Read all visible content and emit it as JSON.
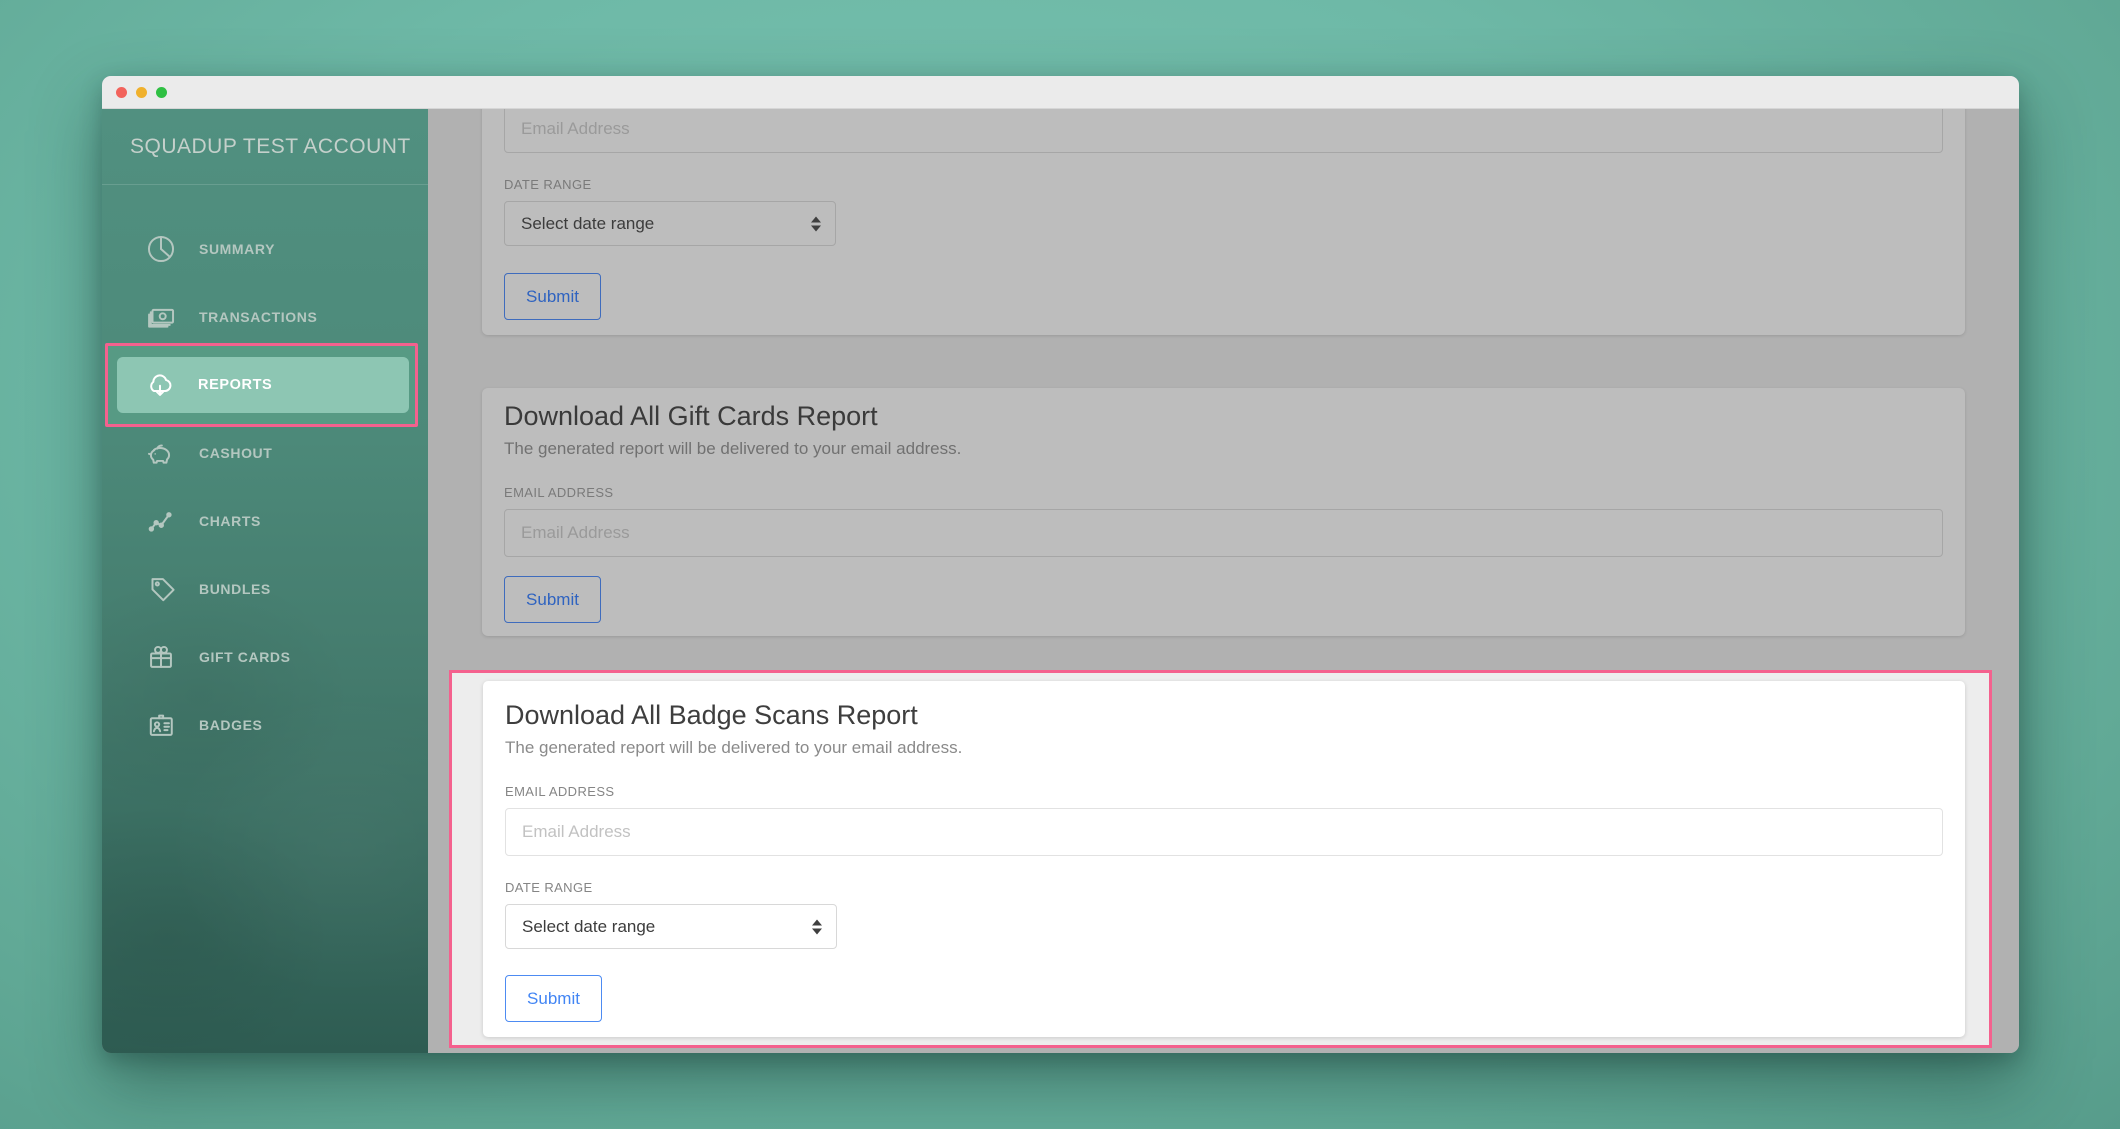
{
  "window": {
    "traffic_lights": [
      "#f2635c",
      "#f0b12d",
      "#2fc043"
    ]
  },
  "sidebar": {
    "account_name": "SQUADUP TEST ACCOUNT",
    "items": [
      {
        "label": "SUMMARY",
        "icon": "pie-chart-icon",
        "active": false
      },
      {
        "label": "TRANSACTIONS",
        "icon": "cash-icon",
        "active": false
      },
      {
        "label": "REPORTS",
        "icon": "cloud-download-icon",
        "active": true
      },
      {
        "label": "CASHOUT",
        "icon": "piggy-bank-icon",
        "active": false
      },
      {
        "label": "CHARTS",
        "icon": "line-chart-icon",
        "active": false
      },
      {
        "label": "BUNDLES",
        "icon": "tag-icon",
        "active": false
      },
      {
        "label": "GIFT CARDS",
        "icon": "gift-icon",
        "active": false
      },
      {
        "label": "BADGES",
        "icon": "id-badge-icon",
        "active": false
      }
    ]
  },
  "main": {
    "cards": {
      "top": {
        "email_placeholder": "Email Address",
        "date_range_label": "DATE RANGE",
        "date_range_value": "Select date range",
        "submit_label": "Submit"
      },
      "gift": {
        "title": "Download All Gift Cards Report",
        "subtitle": "The generated report will be delivered to your email address.",
        "email_label": "EMAIL ADDRESS",
        "email_placeholder": "Email Address",
        "submit_label": "Submit"
      },
      "badge": {
        "title": "Download All Badge Scans Report",
        "subtitle": "The generated report will be delivered to your email address.",
        "email_label": "EMAIL ADDRESS",
        "email_placeholder": "Email Address",
        "date_range_label": "DATE RANGE",
        "date_range_value": "Select date range",
        "submit_label": "Submit"
      }
    }
  },
  "colors": {
    "annotation_pink": "#f4618e",
    "accent_blue": "#4285f4",
    "sidebar_active_bg": "#8dc6b3",
    "page_teal": "#6eb9a7"
  }
}
